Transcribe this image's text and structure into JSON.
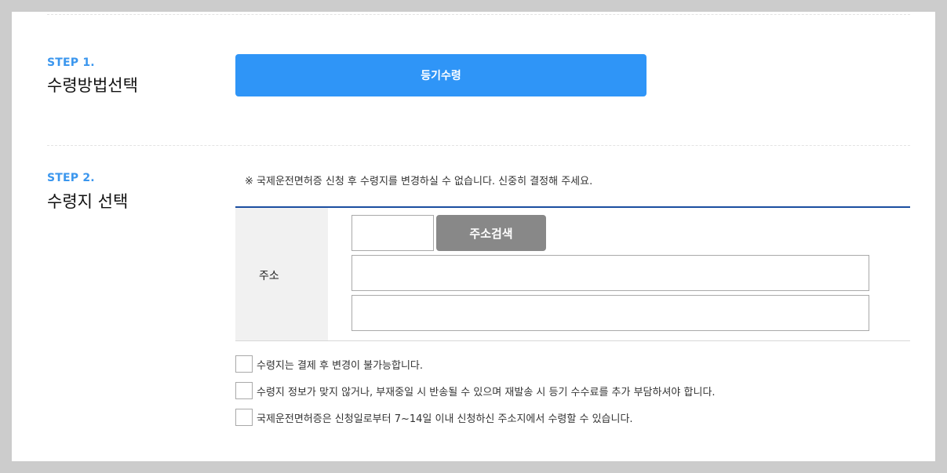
{
  "step1": {
    "label": "STEP 1.",
    "title": "수령방법선택",
    "method_button": "등기수령"
  },
  "step2": {
    "label": "STEP 2.",
    "title": "수령지 선택",
    "notice": "※ 국제운전면허증 신청 후 수령지를 변경하실 수 없습니다. 신중히 결정해 주세요.",
    "address_label": "주소",
    "search_button": "주소검색",
    "zip_value": "",
    "address1_value": "",
    "address2_value": ""
  },
  "agreements": [
    {
      "text": "수령지는 결제 후 변경이 불가능합니다.",
      "checked": false
    },
    {
      "text": "수령지 정보가 맞지 않거나, 부재중일 시 반송될 수 있으며 재발송 시 등기 수수료를 추가 부담하셔야 합니다.",
      "checked": false
    },
    {
      "text": "국제운전면허증은 신청일로부터 7~14일 이내 신청하신 주소지에서 수령할 수 있습니다.",
      "checked": false
    }
  ],
  "colors": {
    "step_accent": "#3a96ee",
    "primary_button": "#2f95f7",
    "search_button": "#888888",
    "table_top_border": "#1b4ea0"
  }
}
